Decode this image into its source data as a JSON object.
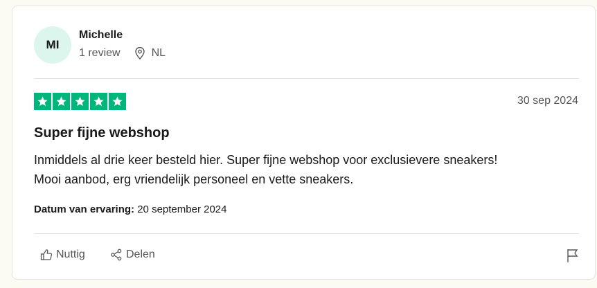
{
  "reviewer": {
    "initials": "MI",
    "name": "Michelle",
    "review_count": "1 review",
    "country": "NL"
  },
  "review": {
    "rating": 5,
    "date": "30 sep 2024",
    "title": "Super fijne webshop",
    "body_line1": "Inmiddels al drie keer besteld hier. Super fijne webshop voor exclusievere sneakers!",
    "body_line2": "Mooi aanbod, erg vriendelijk personeel en vette sneakers.",
    "experience_label": "Datum van ervaring:",
    "experience_date": "20 september 2024"
  },
  "actions": {
    "useful": "Nuttig",
    "share": "Delen"
  },
  "colors": {
    "star_green": "#00b67a",
    "avatar_bg": "#dcf6ee"
  }
}
